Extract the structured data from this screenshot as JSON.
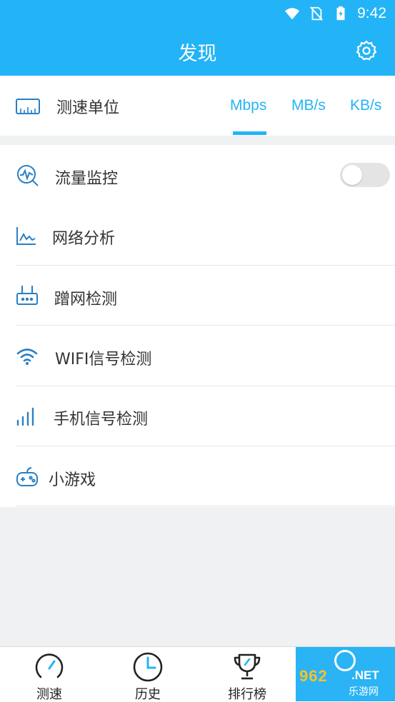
{
  "status_bar": {
    "time": "9:42",
    "icons": [
      "wifi-icon",
      "no-sim-icon",
      "battery-charging-icon"
    ]
  },
  "header": {
    "title": "发现",
    "settings_icon": "gear-icon",
    "background_color": "#23b4f7"
  },
  "speed_unit": {
    "label": "测速单位",
    "icon": "ruler-icon",
    "options": [
      "Mbps",
      "MB/s",
      "KB/s"
    ],
    "selected": "Mbps",
    "accent_color": "#23b4f7"
  },
  "features": {
    "items": [
      {
        "label": "流量监控",
        "icon": "traffic-monitor-icon",
        "toggle": false
      },
      {
        "label": "网络分析",
        "icon": "network-chart-icon"
      },
      {
        "label": "蹭网检测",
        "icon": "router-icon"
      },
      {
        "label": "WIFI信号检测",
        "icon": "wifi-icon"
      },
      {
        "label": "手机信号检测",
        "icon": "signal-bars-icon"
      },
      {
        "label": "小游戏",
        "icon": "gamepad-icon"
      }
    ]
  },
  "bottom_nav": {
    "items": [
      {
        "label": "测速",
        "icon": "speedometer-icon"
      },
      {
        "label": "历史",
        "icon": "clock-icon"
      },
      {
        "label": "排行榜",
        "icon": "trophy-icon"
      }
    ]
  },
  "watermark": {
    "brand": "962",
    "domain": ".NET",
    "subtitle": "乐游网"
  }
}
